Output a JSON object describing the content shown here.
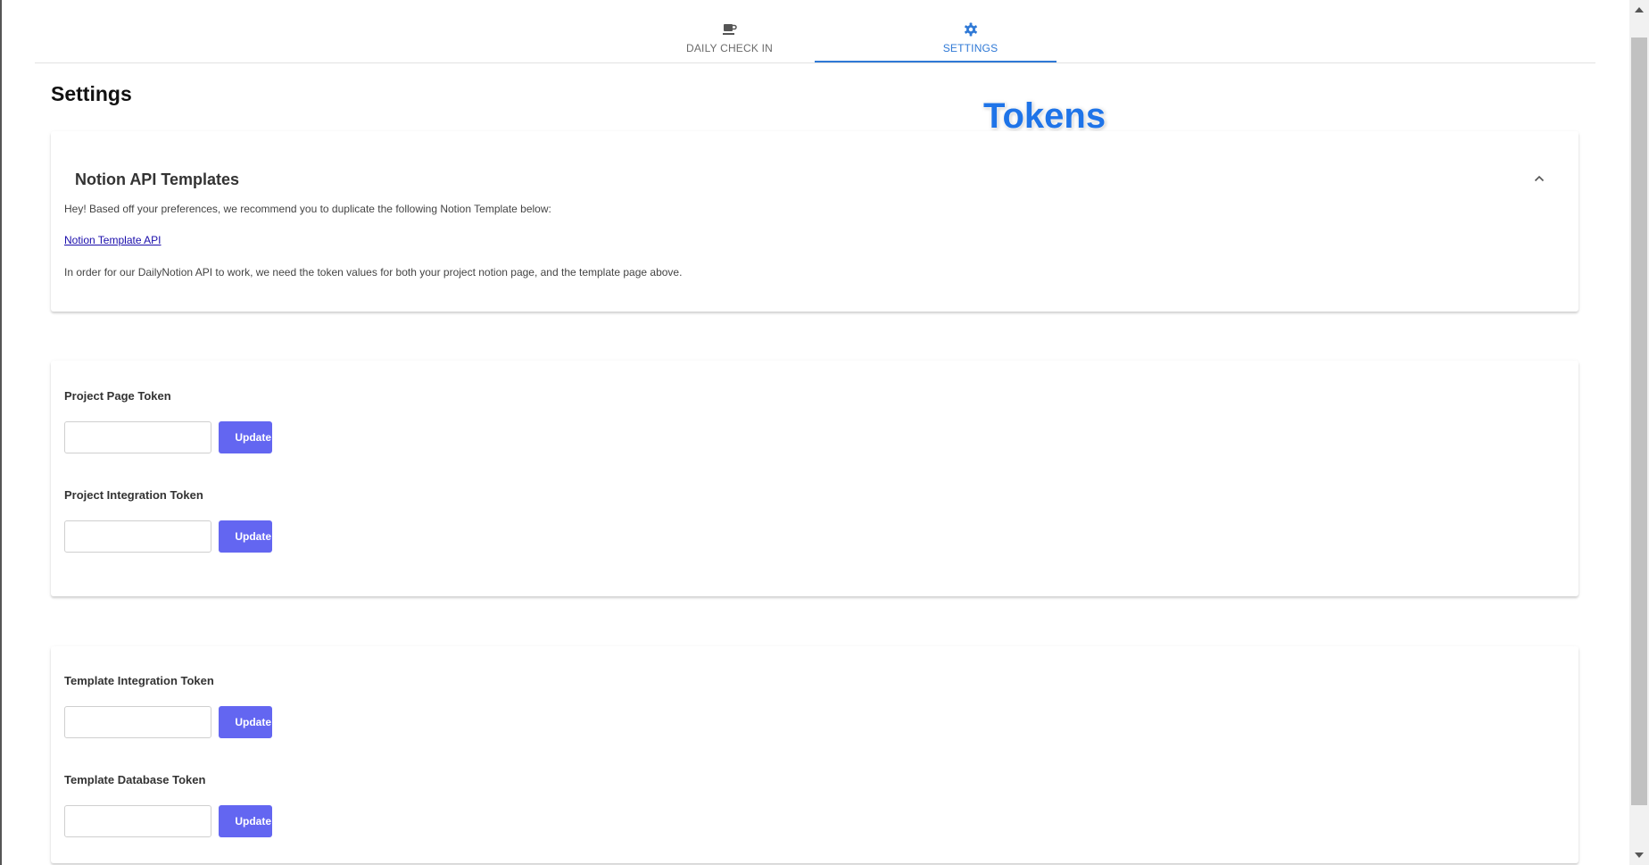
{
  "tabs": [
    {
      "label": "DAILY CHECK IN",
      "icon": "coffee-icon",
      "active": false
    },
    {
      "label": "SETTINGS",
      "icon": "gear-icon",
      "active": true
    }
  ],
  "page": {
    "title": "Settings"
  },
  "overlay": {
    "label": "Tokens"
  },
  "notion_card": {
    "title": "Notion API Templates",
    "intro": "Hey! Based off your preferences, we recommend you to duplicate the following Notion Template below:",
    "link_text": "Notion Template API",
    "note": "In order for our DailyNotion API to work, we need the token values for both your project notion page, and the template page above."
  },
  "project_card": {
    "fields": [
      {
        "label": "Project Page Token",
        "value": "",
        "button": "Update"
      },
      {
        "label": "Project Integration Token",
        "value": "",
        "button": "Update"
      }
    ]
  },
  "template_card": {
    "fields": [
      {
        "label": "Template Integration Token",
        "value": "",
        "button": "Update"
      },
      {
        "label": "Template Database Token",
        "value": "",
        "button": "Update"
      }
    ]
  },
  "colors": {
    "accent": "#2f79d6",
    "button": "#6366f1",
    "overlay_label": "#1f74e8",
    "link": "#1a0dab"
  }
}
